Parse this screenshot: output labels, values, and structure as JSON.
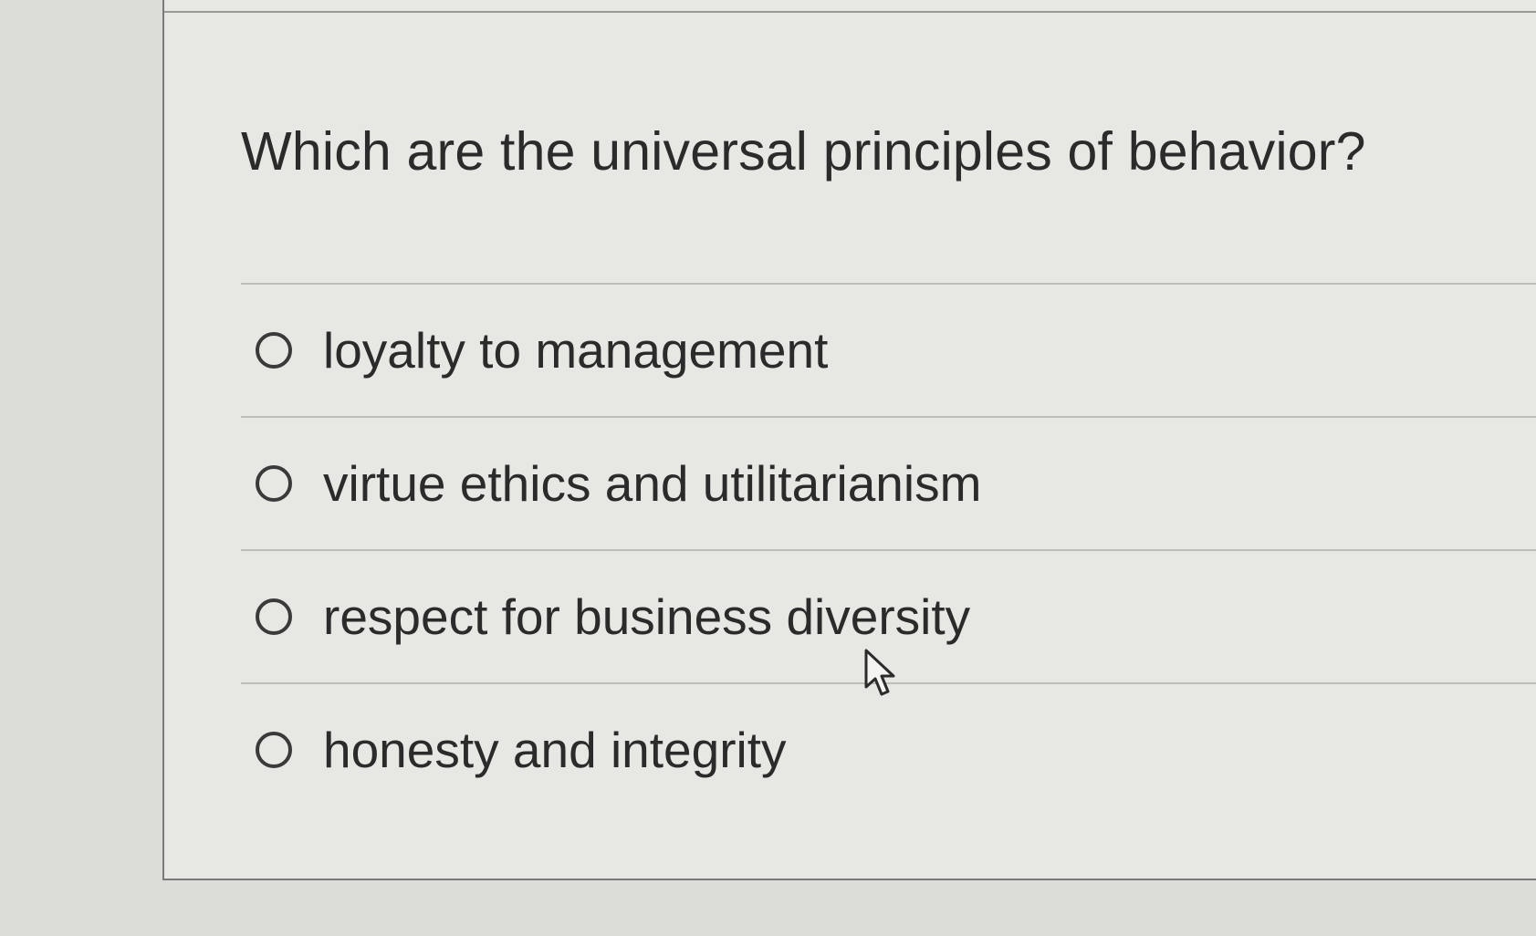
{
  "question": {
    "title": "Which are the universal principles of behavior?"
  },
  "options": [
    {
      "label": "loyalty to management",
      "selected": false
    },
    {
      "label": "virtue ethics and utilitarianism",
      "selected": false
    },
    {
      "label": "respect for business diversity",
      "selected": false
    },
    {
      "label": "honesty and integrity",
      "selected": false
    }
  ],
  "cursor": {
    "icon": "arrow-pointer-icon"
  },
  "colors": {
    "background": "#dcdcd9",
    "card": "#e7e7e4",
    "text": "#2b2b2b"
  }
}
